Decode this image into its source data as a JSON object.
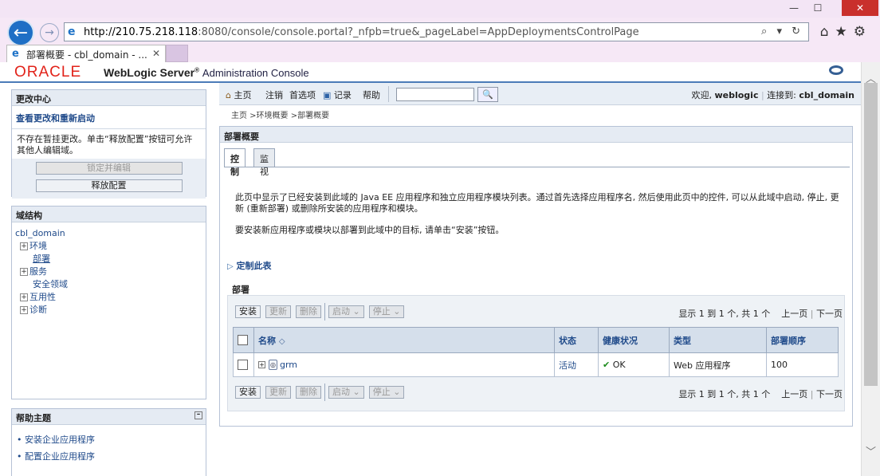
{
  "browser": {
    "url_host": "http://210.75.218.118",
    "url_rest": ":8080/console/console.portal?_nfpb=true&_pageLabel=AppDeploymentsControlPage",
    "address_tools": "⌕ ▾ ↻",
    "tab_title": "部署概要 - cbl_domain - ...",
    "tab_close": "✕",
    "win_min": "—",
    "win_max": "☐",
    "win_close": "✕",
    "back": "←",
    "forward": "→",
    "top_icons": "⌂★⚙"
  },
  "header": {
    "oracle": "ORACLE",
    "product": "WebLogic Server",
    "reg": "®",
    "subtitle": "Administration Console"
  },
  "change_center": {
    "title": "更改中心",
    "link": "查看更改和重新启动",
    "text": "不存在暂挂更改。单击“释放配置”按钮可允许其他人编辑域。",
    "lock_button": "锁定并编辑",
    "release_button": "释放配置"
  },
  "domain_structure": {
    "title": "域结构",
    "root": "cbl_domain",
    "items": [
      {
        "label": "环境",
        "expandable": true
      },
      {
        "label": "部署",
        "expandable": false
      },
      {
        "label": "服务",
        "expandable": true
      },
      {
        "label": "安全领域",
        "expandable": false
      },
      {
        "label": "互用性",
        "expandable": true
      },
      {
        "label": "诊断",
        "expandable": true
      }
    ]
  },
  "help_topics": {
    "title": "帮助主题",
    "toggle": "–",
    "items": [
      "安装企业应用程序",
      "配置企业应用程序"
    ]
  },
  "toolbar": {
    "home": "主页",
    "logout": "注销",
    "prefs": "首选项",
    "record": "记录",
    "help": "帮助",
    "search_placeholder": "",
    "search_icon": "🔍",
    "welcome_prefix": "欢迎,",
    "user": "weblogic",
    "connected_prefix": "连接到:",
    "domain": "cbl_domain"
  },
  "breadcrumb": "主页 >环境概要 >部署概要",
  "content": {
    "title": "部署概要",
    "tabs": [
      "控制",
      "监视"
    ],
    "desc1": "此页中显示了已经安装到此域的 Java EE 应用程序和独立应用程序模块列表。通过首先选择应用程序名, 然后使用此页中的控件, 可以从此域中启动, 停止, 更新 (重新部署) 或删除所安装的应用程序和模块。",
    "desc2": "要安装新应用程序或模块以部署到此域中的目标, 请单击“安装”按钮。",
    "customize": "定制此表",
    "section_title": "部署",
    "buttons": {
      "install": "安装",
      "update": "更新",
      "delete": "删除",
      "start": "启动",
      "stop": "停止"
    },
    "pager": {
      "info": "显示 1 到 1 个, 共 1 个",
      "prev": "上一页",
      "sep": "|",
      "next": "下一页"
    },
    "columns": [
      "名称",
      "状态",
      "健康状况",
      "类型",
      "部署顺序"
    ],
    "rows": [
      {
        "name": "grm",
        "state": "活动",
        "health": "OK",
        "type": "Web 应用程序",
        "order": "100"
      }
    ]
  },
  "colors": {
    "oracle_red": "#e2231a",
    "link_blue": "#1f4a8a",
    "header_rule": "#4b7bb8"
  }
}
